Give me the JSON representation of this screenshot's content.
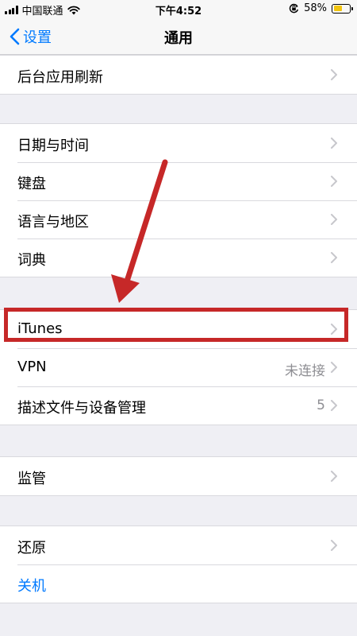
{
  "status_bar": {
    "carrier": "中国联通",
    "time": "下午4:52",
    "battery_percent": "58%",
    "battery_level": 0.58,
    "icons": [
      "signal-icon",
      "wifi-icon",
      "orientation-lock-icon",
      "battery-icon"
    ]
  },
  "nav": {
    "back_label": "设置",
    "title": "通用"
  },
  "groups": [
    {
      "rows": [
        {
          "label": "后台应用刷新",
          "chevron": true
        }
      ]
    },
    {
      "rows": [
        {
          "label": "日期与时间",
          "chevron": true
        },
        {
          "label": "键盘",
          "chevron": true
        },
        {
          "label": "语言与地区",
          "chevron": true
        },
        {
          "label": "词典",
          "chevron": true
        }
      ]
    },
    {
      "rows": [
        {
          "label": "iTunes",
          "chevron": true,
          "highlighted": true
        },
        {
          "label": "VPN",
          "value": "未连接",
          "chevron": true
        },
        {
          "label": "描述文件与设备管理",
          "value": "5",
          "chevron": true
        }
      ]
    },
    {
      "rows": [
        {
          "label": "监管",
          "chevron": true
        }
      ]
    },
    {
      "rows": [
        {
          "label": "还原",
          "chevron": true
        },
        {
          "label": "关机",
          "chevron": false,
          "color": "#007aff"
        }
      ]
    }
  ],
  "annotation": {
    "color": "#c62828",
    "type": "arrow pointing to highlighted iTunes row"
  }
}
